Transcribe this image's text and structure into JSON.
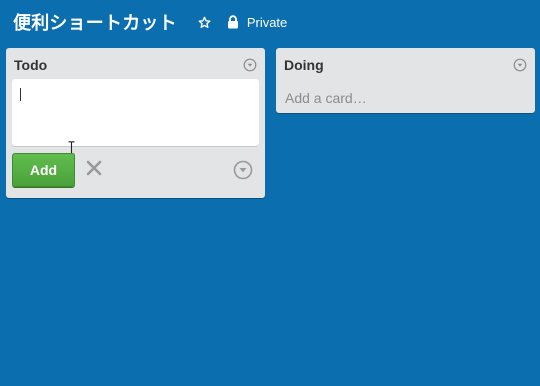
{
  "header": {
    "board_title": "便利ショートカット",
    "star_icon": "star-outline-icon",
    "privacy_label": "Private",
    "lock_icon": "lock-icon"
  },
  "lists": [
    {
      "title": "Todo",
      "menu_icon": "circle-chevron-down-icon",
      "composer": {
        "value": "",
        "add_label": "Add",
        "cancel_icon": "close-icon",
        "options_icon": "circle-chevron-down-icon"
      }
    },
    {
      "title": "Doing",
      "menu_icon": "circle-chevron-down-icon",
      "add_card_label": "Add a card…"
    }
  ],
  "colors": {
    "board_background": "#0b6eaf",
    "list_background": "#e2e4e6",
    "add_button": "#5aac44",
    "text_dark": "#333333",
    "text_muted": "#8c8c8c"
  }
}
